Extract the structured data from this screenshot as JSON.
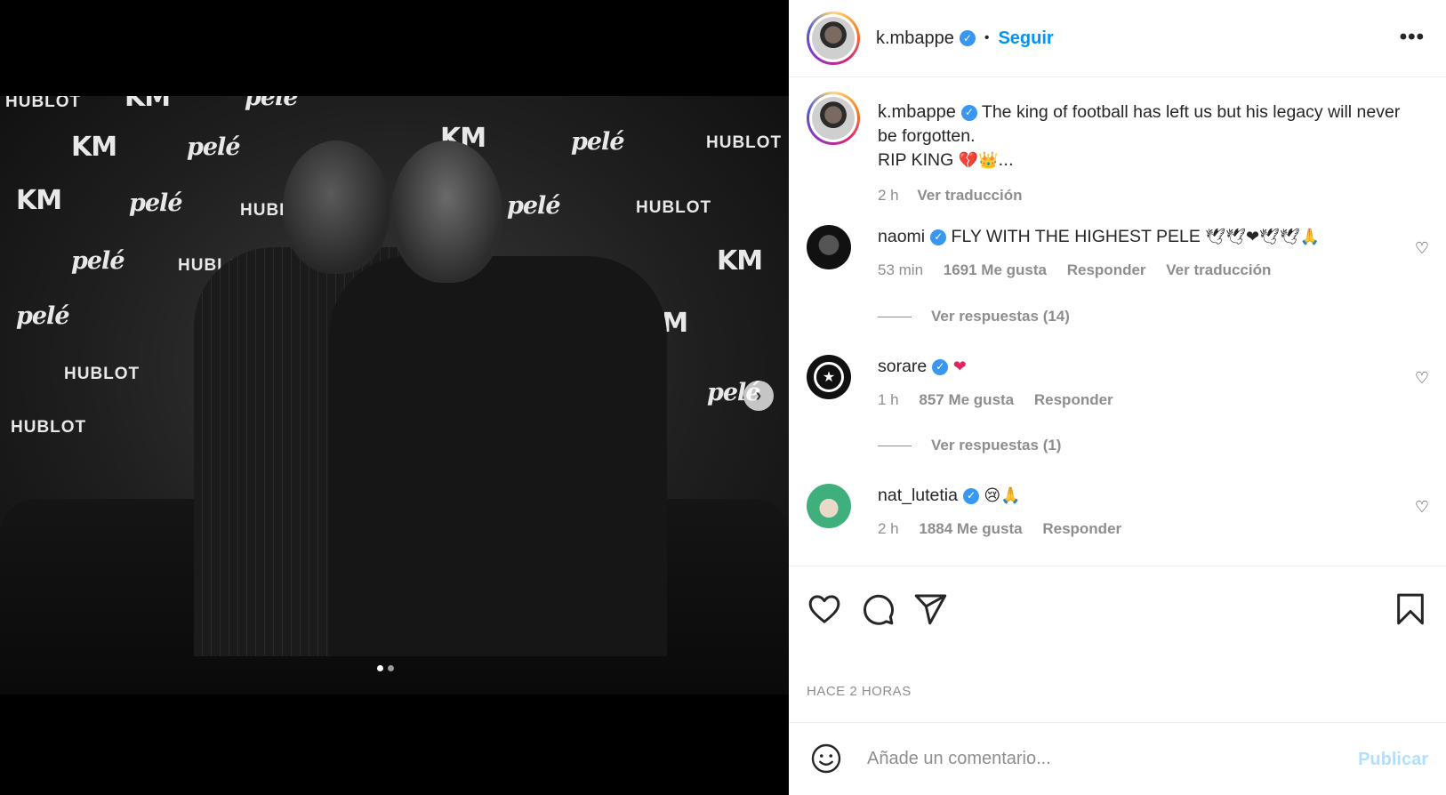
{
  "post": {
    "username": "k.mbappe",
    "follow_label": "Seguir",
    "separator": "•",
    "more_label": "•••",
    "carousel": {
      "current": 1,
      "total": 2
    },
    "photo_wall": {
      "hublot": "HUBLOT",
      "km": "KM",
      "pele": "pelé"
    }
  },
  "caption": {
    "username": "k.mbappe",
    "text_line1": "The king of football has left us but his legacy will never be forgotten.",
    "text_line2": "RIP KING",
    "emojis": "💔👑...",
    "time": "2 h",
    "translate": "Ver traducción"
  },
  "comments": [
    {
      "username": "naomi",
      "text": "FLY WITH THE HIGHEST PELE",
      "emojis": "🕊🕊❤🕊🕊🙏",
      "time": "53 min",
      "likes": "1691 Me gusta",
      "reply": "Responder",
      "translate": "Ver traducción",
      "replies": "Ver respuestas (14)"
    },
    {
      "username": "sorare",
      "text": "",
      "emojis": "❤",
      "time": "1 h",
      "likes": "857 Me gusta",
      "reply": "Responder",
      "replies": "Ver respuestas (1)"
    },
    {
      "username": "nat_lutetia",
      "text": "",
      "emojis": "😢🙏",
      "time": "2 h",
      "likes": "1884 Me gusta",
      "reply": "Responder"
    }
  ],
  "actions": {
    "timestamp": "HACE 2 HORAS",
    "icons": [
      "heart-icon",
      "comment-icon",
      "share-icon",
      "bookmark-icon"
    ]
  },
  "composer": {
    "placeholder": "Añade un comentario...",
    "publish_label": "Publicar"
  }
}
